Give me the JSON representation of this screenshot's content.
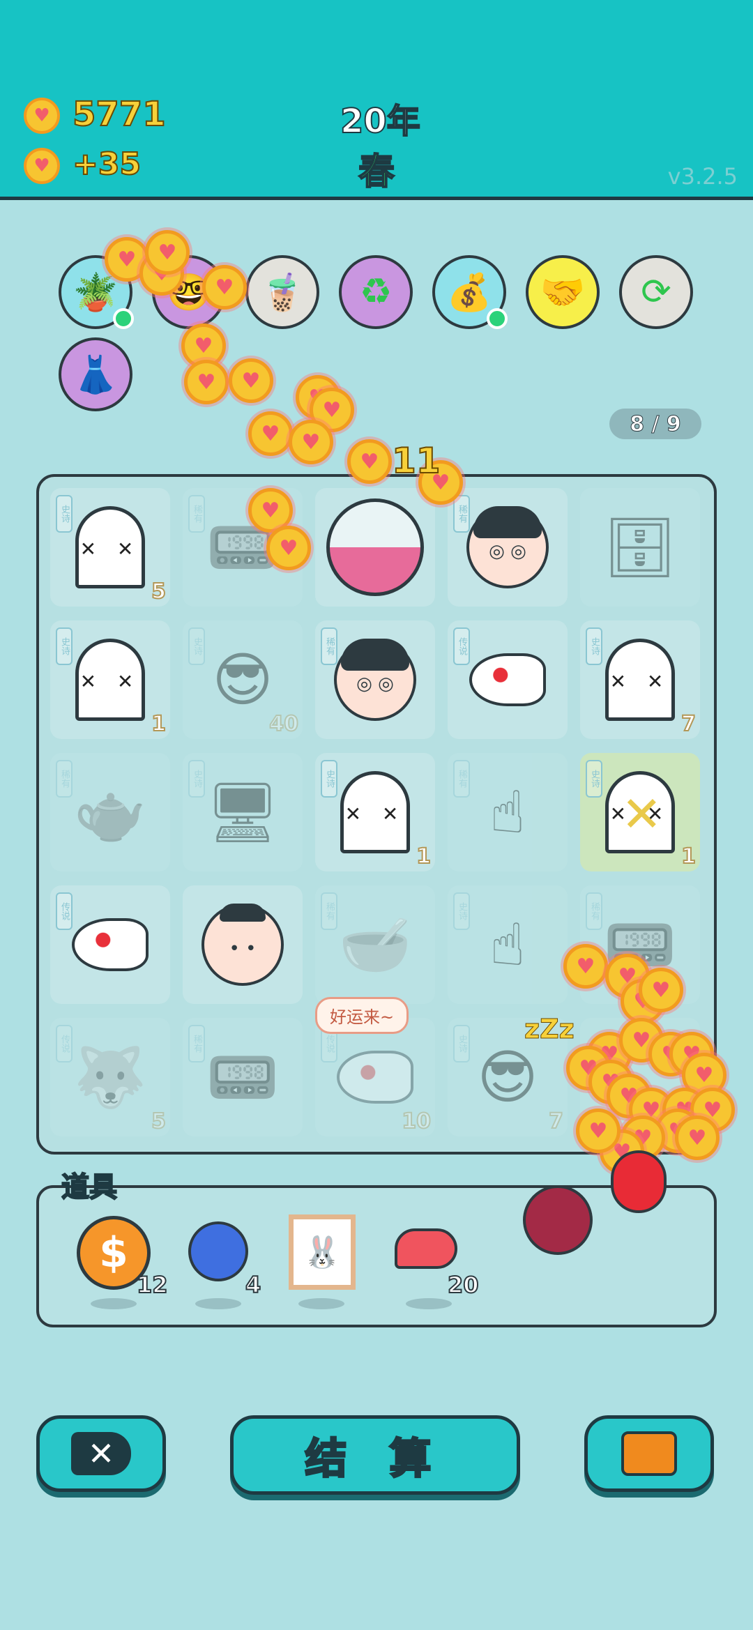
{
  "header": {
    "coins": "5771",
    "income": "+35",
    "year": "20年",
    "season": "春",
    "version": "v3.2.5"
  },
  "progress": "8 / 9",
  "float_number": "11",
  "skills": [
    {
      "name": "flower-pot-icon"
    },
    {
      "name": "character-card-icon"
    },
    {
      "name": "milk-tea-icon"
    },
    {
      "name": "recycle-icon"
    },
    {
      "name": "money-bag-icon"
    },
    {
      "name": "handshake-icon"
    },
    {
      "name": "refresh-icon"
    },
    {
      "name": "skirt-icon"
    }
  ],
  "board": {
    "rows": [
      [
        {
          "item": "ghost",
          "tag": "史诗",
          "count": "5",
          "dim": false
        },
        {
          "item": "machine",
          "tag": "稀有",
          "count": "",
          "dim": true
        },
        {
          "item": "gacha-bowl",
          "tag": "",
          "count": "",
          "dim": false
        },
        {
          "item": "glasses-face",
          "tag": "稀有",
          "count": "",
          "dim": false
        },
        {
          "item": "fridge",
          "tag": "",
          "count": "",
          "dim": true
        }
      ],
      [
        {
          "item": "ghost",
          "tag": "史诗",
          "count": "1",
          "dim": false
        },
        {
          "item": "green-face",
          "tag": "史诗",
          "count": "40",
          "dim": true
        },
        {
          "item": "glasses-face",
          "tag": "稀有",
          "count": "",
          "dim": false
        },
        {
          "item": "koi-fish",
          "tag": "传说",
          "count": "",
          "dim": false
        },
        {
          "item": "ghost",
          "tag": "史诗",
          "count": "7",
          "dim": false
        }
      ],
      [
        {
          "item": "teapot",
          "tag": "稀有",
          "count": "",
          "dim": true
        },
        {
          "item": "server",
          "tag": "史诗",
          "count": "",
          "dim": true
        },
        {
          "item": "ghost",
          "tag": "史诗",
          "count": "1",
          "dim": false
        },
        {
          "item": "pointing-hand",
          "tag": "稀有",
          "count": "",
          "dim": true
        },
        {
          "item": "ghost-x",
          "tag": "史诗",
          "count": "1",
          "dim": false
        }
      ],
      [
        {
          "item": "koi-fish",
          "tag": "传说",
          "count": "",
          "dim": false
        },
        {
          "item": "bald-face",
          "tag": "",
          "count": "",
          "dim": false
        },
        {
          "item": "gacha-bowl",
          "tag": "稀有",
          "count": "",
          "dim": true
        },
        {
          "item": "pointing-hand",
          "tag": "史诗",
          "count": "",
          "dim": true
        },
        {
          "item": "machine",
          "tag": "稀有",
          "count": "",
          "dim": true
        }
      ],
      [
        {
          "item": "husky-king",
          "tag": "传说",
          "count": "5",
          "dim": true
        },
        {
          "item": "machine",
          "tag": "稀有",
          "count": "",
          "dim": true
        },
        {
          "item": "koi-fish",
          "tag": "传说",
          "count": "10",
          "dim": true
        },
        {
          "item": "green-face",
          "tag": "史诗",
          "count": "7",
          "dim": true
        },
        {
          "item": "empty",
          "tag": "",
          "count": "",
          "dim": true
        }
      ]
    ],
    "speech": "好运来~"
  },
  "tools": {
    "title": "道具",
    "items": [
      {
        "name": "dollar-coin-icon",
        "count": "12"
      },
      {
        "name": "blueberry-icon",
        "count": "4"
      },
      {
        "name": "bunny-frame-icon",
        "count": ""
      },
      {
        "name": "liver-icon",
        "count": "20"
      }
    ]
  },
  "buttons": {
    "settle": "结 算"
  }
}
